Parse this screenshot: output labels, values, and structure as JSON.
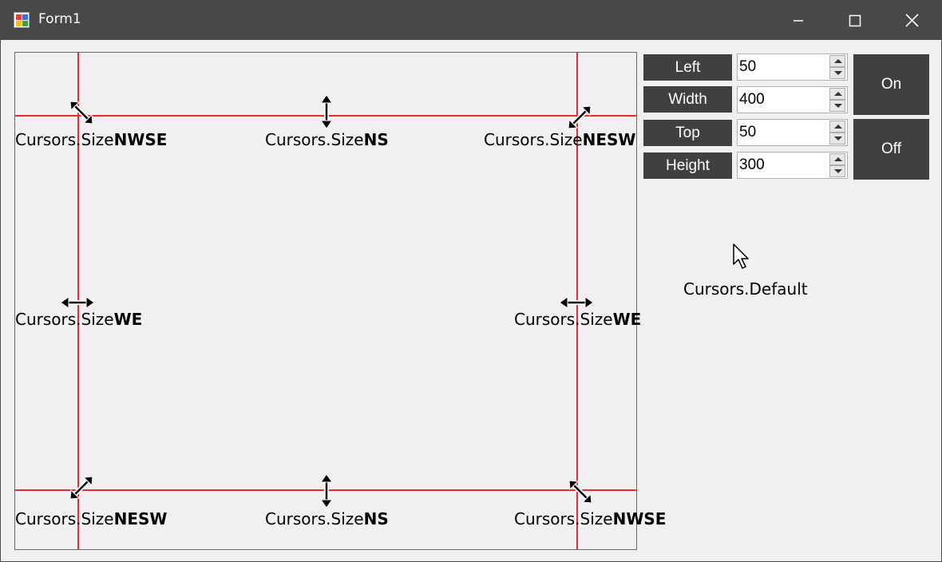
{
  "window": {
    "title": "Form1",
    "icons": {
      "app": "form-app-icon",
      "minimize": "minimize-icon",
      "maximize": "maximize-icon",
      "close": "close-icon"
    }
  },
  "panel": {
    "line_color": "#e03030",
    "cursors": [
      {
        "id": "top-left",
        "icon": "size-nwse-cursor-icon",
        "prefix": "Cursors.Size",
        "suffix": "NWSE"
      },
      {
        "id": "top-center",
        "icon": "size-ns-cursor-icon",
        "prefix": "Cursors.Size",
        "suffix": "NS"
      },
      {
        "id": "top-right",
        "icon": "size-nesw-cursor-icon",
        "prefix": "Cursors.Size",
        "suffix": "NESW"
      },
      {
        "id": "mid-left",
        "icon": "size-we-cursor-icon",
        "prefix": "Cursors.Size",
        "suffix": "WE"
      },
      {
        "id": "mid-right",
        "icon": "size-we-cursor-icon",
        "prefix": "Cursors.Size",
        "suffix": "WE"
      },
      {
        "id": "bottom-left",
        "icon": "size-nesw-cursor-icon",
        "prefix": "Cursors.Size",
        "suffix": "NESW"
      },
      {
        "id": "bottom-center",
        "icon": "size-ns-cursor-icon",
        "prefix": "Cursors.Size",
        "suffix": "NS"
      },
      {
        "id": "bottom-right",
        "icon": "size-nwse-cursor-icon",
        "prefix": "Cursors.Size",
        "suffix": "NWSE"
      }
    ]
  },
  "controls": {
    "left": {
      "label": "Left",
      "value": "50"
    },
    "width": {
      "label": "Width",
      "value": "400"
    },
    "top": {
      "label": "Top",
      "value": "50"
    },
    "height": {
      "label": "Height",
      "value": "300"
    },
    "on_button": "On",
    "off_button": "Off",
    "accent_color": "#404040"
  },
  "default_cursor": {
    "icon": "arrow-cursor-icon",
    "label": "Cursors.Default"
  }
}
